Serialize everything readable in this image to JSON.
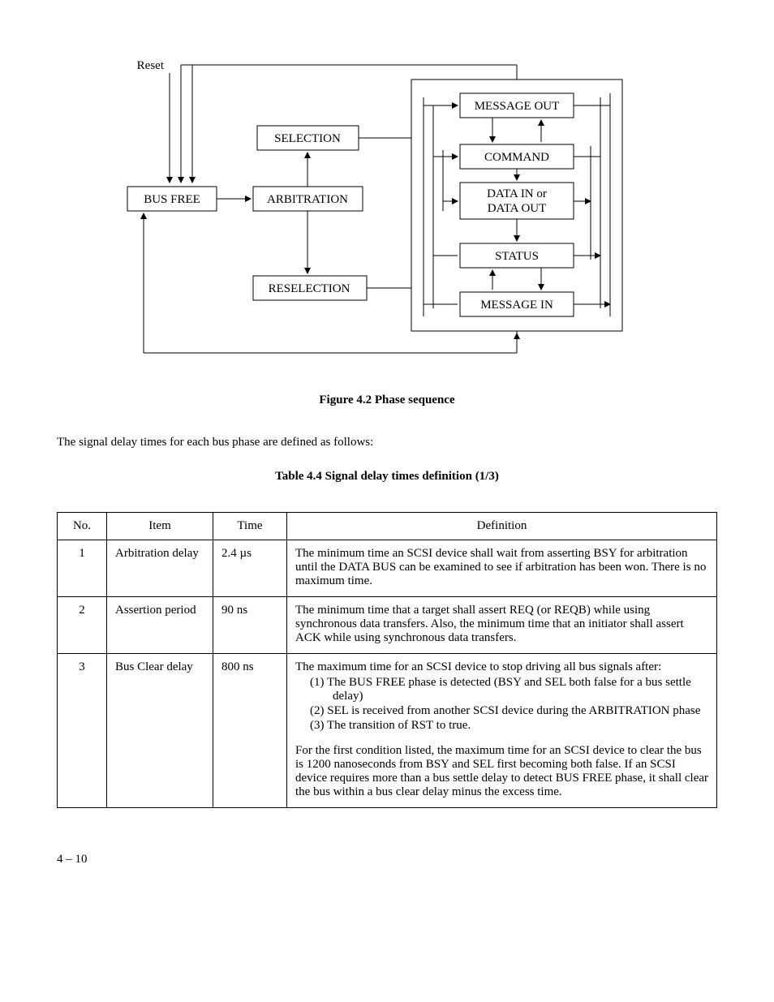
{
  "diagram": {
    "reset": "Reset",
    "bus_free": "BUS FREE",
    "arbitration": "ARBITRATION",
    "selection": "SELECTION",
    "reselection": "RESELECTION",
    "msg_out": "MESSAGE OUT",
    "command": "COMMAND",
    "data": "DATA IN or\nDATA OUT",
    "status": "STATUS",
    "msg_in": "MESSAGE IN"
  },
  "figure_caption": "Figure 4.2   Phase sequence",
  "lead_text": "The signal delay times for each bus phase are defined as follows:",
  "table_caption": "Table 4.4   Signal delay times definition (1/3)",
  "table": {
    "headers": {
      "no": "No.",
      "item": "Item",
      "time": "Time",
      "definition": "Definition"
    },
    "rows": [
      {
        "no": "1",
        "item": "Arbitration delay",
        "time": "2.4 µs",
        "def_paras": [
          "The minimum time an SCSI device shall wait from asserting BSY for arbitration until the DATA BUS can be examined to see if arbitration has been won.  There is no maximum time."
        ]
      },
      {
        "no": "2",
        "item": "Assertion period",
        "time": "90 ns",
        "def_paras": [
          "The minimum time that a target shall assert REQ (or REQB) while using synchronous data transfers.  Also, the minimum time that an initiator shall assert ACK while using synchronous data transfers."
        ]
      },
      {
        "no": "3",
        "item": "Bus Clear delay",
        "time": "800 ns",
        "def_intro": "The maximum time for an SCSI device to stop driving all bus signals after:",
        "def_list": [
          "(1)  The BUS FREE phase is detected (BSY and SEL both false for a bus settle delay)",
          "(2)  SEL is received from another SCSI device during the ARBITRATION phase",
          "(3)  The transition of RST to true."
        ],
        "def_after": "For the first condition listed, the maximum time for an SCSI device to clear the bus is 1200 nanoseconds from BSY and SEL first becoming both false.  If an SCSI device requires more than a bus settle delay to detect BUS FREE phase, it shall clear the bus within a bus clear delay minus the excess time."
      }
    ]
  },
  "page_number": "4 – 10"
}
